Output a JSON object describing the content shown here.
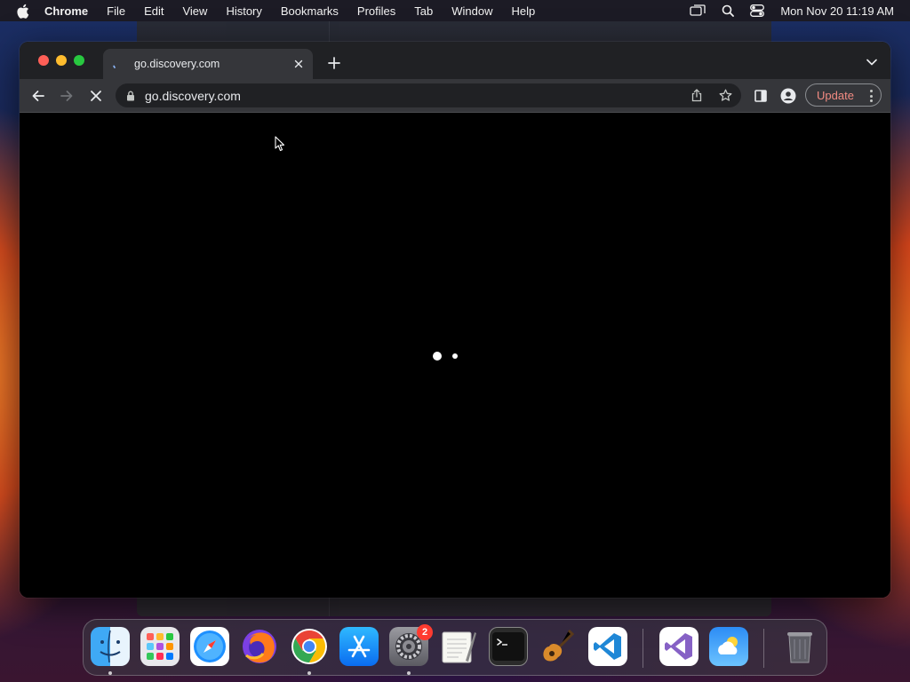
{
  "menubar": {
    "app_name": "Chrome",
    "items": [
      "File",
      "Edit",
      "View",
      "History",
      "Bookmarks",
      "Profiles",
      "Tab",
      "Window",
      "Help"
    ],
    "clock": "Mon Nov 20  11:19 AM"
  },
  "browser": {
    "tab_title": "go.discovery.com",
    "url": "go.discovery.com",
    "update_label": "Update",
    "update_color": "#f28b82"
  },
  "dock": {
    "apps": [
      "finder",
      "launchpad",
      "safari",
      "firefox",
      "chrome",
      "app-store",
      "system-settings",
      "textedit",
      "terminal",
      "garageband",
      "vscode",
      "visual-studio",
      "weather",
      "trash"
    ],
    "settings_badge": "2"
  }
}
